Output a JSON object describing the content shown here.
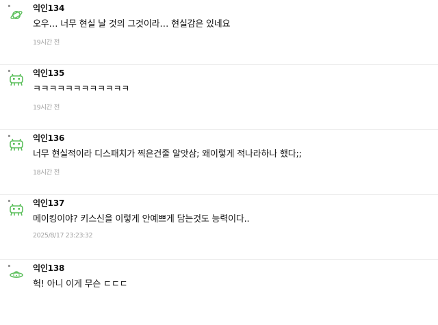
{
  "comments": [
    {
      "author": "익인134",
      "text": "오우… 너무 현실 날 것의 그것이라… 현실감은 있네요",
      "time": "19시간 전",
      "avatar": "planet-icon"
    },
    {
      "author": "익인135",
      "text": "ㅋㅋㅋㅋㅋㅋㅋㅋㅋㅋㅋㅋ",
      "time": "19시간 전",
      "avatar": "alien-icon"
    },
    {
      "author": "익인136",
      "text": "너무 현실적이라 디스패치가 찍은건줄 알앗삼; 왜이렇게 적나라하나 했다;;",
      "time": "18시간 전",
      "avatar": "alien-icon"
    },
    {
      "author": "익인137",
      "text": "메이킹이야? 키스신을 이렇게 안예쁘게 담는것도 능력이다..",
      "time": "2025/8/17 23:23:32",
      "avatar": "alien-icon"
    },
    {
      "author": "익인138",
      "text": "헉! 아니 이게 무슨 ㄷㄷㄷ",
      "time": "",
      "avatar": "ufo-icon"
    }
  ],
  "colors": {
    "avatar_green": "#5cbf5c",
    "meta_gray": "#a2a2a2"
  }
}
